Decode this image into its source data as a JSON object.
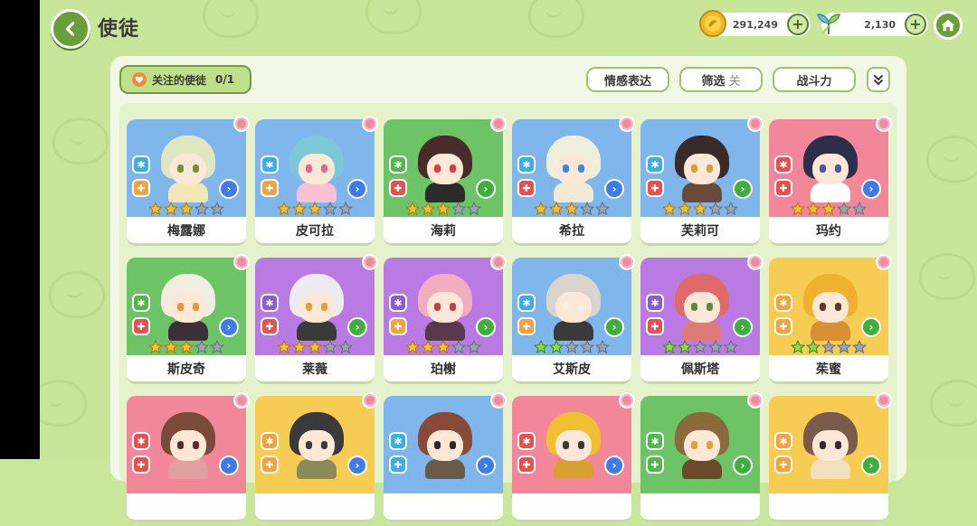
{
  "header": {
    "title": "使徒",
    "gold_amount": "291,249",
    "gem_amount": "2,130",
    "plus_label": "+"
  },
  "toolbar": {
    "follow_label": "关注的使徒",
    "follow_count": "0/1",
    "emotion_label": "情感表达",
    "filter_label": "筛选",
    "filter_state": "关",
    "power_label": "战斗力"
  },
  "colors": {
    "background": "#c8e69a",
    "accent_green": "#6a9e3b",
    "card_blue": "#7fb6ec",
    "card_green": "#6cc466",
    "card_pink": "#f2879a",
    "card_purple": "#b97ae3",
    "card_yellow": "#f6cc52"
  },
  "cards": [
    {
      "name": "梅露娜",
      "bg": "#7fb6ec",
      "stars": 3,
      "el1": "#3aaee8",
      "el2": "#f5a23c",
      "arrow": "#3c7be8",
      "hair": "#dfe6c2",
      "body": "#f3e6b5",
      "eye": "#7a8f3a"
    },
    {
      "name": "皮可拉",
      "bg": "#7fb6ec",
      "stars": 3,
      "el1": "#3aaee8",
      "el2": "#f5a23c",
      "arrow": "#3c7be8",
      "hair": "#7cc7d8",
      "body": "#f7c2d3",
      "eye": "#e06a8a"
    },
    {
      "name": "海莉",
      "bg": "#6cc466",
      "stars": 3,
      "el1": "#53b84c",
      "el2": "#e85050",
      "arrow": "#3fae3d",
      "hair": "#4a2b2b",
      "body": "#2b2b2b",
      "eye": "#e03a4a"
    },
    {
      "name": "希拉",
      "bg": "#7fb6ec",
      "stars": 3,
      "el1": "#3aaee8",
      "el2": "#e85050",
      "arrow": "#3c7be8",
      "hair": "#eef0dc",
      "body": "#f1e9d2",
      "eye": "#3a8bd8"
    },
    {
      "name": "芙莉可",
      "bg": "#7fb6ec",
      "stars": 3,
      "el1": "#3aaee8",
      "el2": "#e85050",
      "arrow": "#3fae3d",
      "hair": "#3a2a2a",
      "body": "#6a4a3a",
      "eye": "#d0a03a"
    },
    {
      "name": "玛约",
      "bg": "#f2879a",
      "stars": 3,
      "el1": "#e85050",
      "el2": "#e85050",
      "arrow": "#3c7be8",
      "hair": "#2d2f4a",
      "body": "#ffffff",
      "eye": "#4a5a9a"
    },
    {
      "name": "斯皮奇",
      "bg": "#6cc466",
      "stars": 3,
      "el1": "#53b84c",
      "el2": "#e85050",
      "arrow": "#3c7be8",
      "hair": "#f1ede0",
      "body": "#3a3038",
      "eye": "#e09a3a"
    },
    {
      "name": "莱薇",
      "bg": "#b97ae3",
      "stars": 3,
      "el1": "#8a5ad8",
      "el2": "#e85050",
      "arrow": "#3fae3d",
      "hair": "#ecebef",
      "body": "#3a3a3a",
      "eye": "#e0a03a"
    },
    {
      "name": "珀榭",
      "bg": "#b97ae3",
      "stars": 3,
      "el1": "#8a5ad8",
      "el2": "#f5a23c",
      "arrow": "#3fae3d",
      "hair": "#f2aec0",
      "body": "#5a3a4a",
      "eye": "#c04050"
    },
    {
      "name": "艾斯皮",
      "bg": "#7fb6ec",
      "stars": 2,
      "el1": "#3aaee8",
      "el2": "#f5a23c",
      "arrow": "#3fae3d",
      "hair": "#d9d5cd",
      "body": "#3a3a3a",
      "eye": "#f5f0e0"
    },
    {
      "name": "佩斯塔",
      "bg": "#b97ae3",
      "stars": 2,
      "el1": "#8a5ad8",
      "el2": "#e85050",
      "arrow": "#3fae3d",
      "hair": "#e06a6a",
      "body": "#e07a7a",
      "eye": "#5a8a3a"
    },
    {
      "name": "茱蜜",
      "bg": "#f6cc52",
      "stars": 2,
      "el1": "#f5a23c",
      "el2": "#f5a23c",
      "arrow": "#3fae3d",
      "hair": "#f0b030",
      "body": "#d89030",
      "eye": "#5a3a2a"
    },
    {
      "name": "",
      "bg": "#f2879a",
      "stars": 0,
      "el1": "#e85050",
      "el2": "#e85050",
      "arrow": "#3c7be8",
      "hair": "#7a4a3a",
      "body": "#e0a0a0",
      "eye": "#5a2a2a"
    },
    {
      "name": "",
      "bg": "#f6cc52",
      "stars": 0,
      "el1": "#f5a23c",
      "el2": "#f5a23c",
      "arrow": "#3c7be8",
      "hair": "#3a3a3a",
      "body": "#8a8a5a",
      "eye": "#3a3a3a"
    },
    {
      "name": "",
      "bg": "#7fb6ec",
      "stars": 0,
      "el1": "#3aaee8",
      "el2": "#3aaee8",
      "arrow": "#3c7be8",
      "hair": "#8a4a3a",
      "body": "#6a5a4a",
      "eye": "#2a2a2a"
    },
    {
      "name": "",
      "bg": "#f2879a",
      "stars": 0,
      "el1": "#e85050",
      "el2": "#e85050",
      "arrow": "#3c7be8",
      "hair": "#f0c030",
      "body": "#d8a030",
      "eye": "#3a3a3a"
    },
    {
      "name": "",
      "bg": "#6cc466",
      "stars": 0,
      "el1": "#53b84c",
      "el2": "#53b84c",
      "arrow": "#3fae3d",
      "hair": "#8a6a3a",
      "body": "#6a4a2a",
      "eye": "#e0a03a"
    },
    {
      "name": "",
      "bg": "#f6cc52",
      "stars": 0,
      "el1": "#f5a23c",
      "el2": "#f5a23c",
      "arrow": "#3fae3d",
      "hair": "#7a5a4a",
      "body": "#f0e0c0",
      "eye": "#3a2a2a"
    }
  ]
}
